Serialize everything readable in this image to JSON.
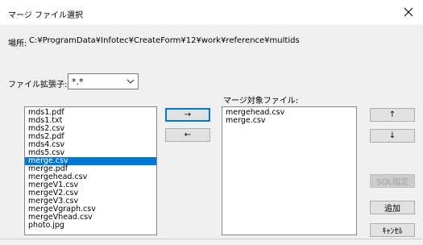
{
  "window": {
    "title": "マージ ファイル選択"
  },
  "location": {
    "label": "場所:",
    "path": "C:¥ProgramData¥Infotec¥CreateForm¥12¥work¥reference¥multids"
  },
  "extension": {
    "label": "ファイル拡張子:",
    "value": "*.*"
  },
  "source_list": {
    "items": [
      "mds1.pdf",
      "mds1.txt",
      "mds2.csv",
      "mds2.pdf",
      "mds4.csv",
      "mds5.csv",
      "merge.csv",
      "merge.pdf",
      "mergehead.csv",
      "mergeV1.csv",
      "mergeV2.csv",
      "mergeV3.csv",
      "mergeVgraph.csv",
      "mergeVhead.csv",
      "photo.jpg"
    ],
    "selected": "merge.csv"
  },
  "target": {
    "label": "マージ対象ファイル:",
    "items": [
      "mergehead.csv",
      "merge.csv"
    ]
  },
  "buttons": {
    "add_right": "→",
    "remove_left": "←",
    "move_up": "↑",
    "move_down": "↓",
    "sql": "SQL指定",
    "add": "追加",
    "cancel": "ｷｬﾝｾﾙ"
  },
  "icons": {
    "close": "close-icon",
    "dropdown": "chevron-down-icon"
  }
}
